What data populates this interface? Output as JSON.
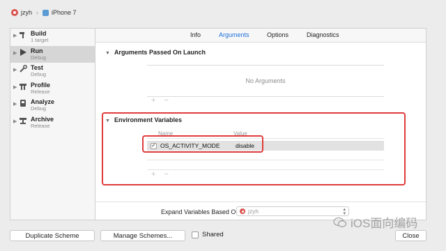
{
  "breadcrumb": {
    "project": "jzyh",
    "device": "iPhone 7"
  },
  "sidebar": {
    "items": [
      {
        "label": "Build",
        "sub": "1 target",
        "icon": "hammer-icon"
      },
      {
        "label": "Run",
        "sub": "Debug",
        "icon": "play-icon"
      },
      {
        "label": "Test",
        "sub": "Debug",
        "icon": "wrench-icon"
      },
      {
        "label": "Profile",
        "sub": "Release",
        "icon": "instruments-icon"
      },
      {
        "label": "Analyze",
        "sub": "Debug",
        "icon": "analyze-icon"
      },
      {
        "label": "Archive",
        "sub": "Release",
        "icon": "archive-icon"
      }
    ]
  },
  "tabs": [
    "Info",
    "Arguments",
    "Options",
    "Diagnostics"
  ],
  "active_tab": "Arguments",
  "arguments": {
    "title": "Arguments Passed On Launch",
    "empty_text": "No Arguments"
  },
  "environment": {
    "title": "Environment Variables",
    "col_name": "Name",
    "col_value": "Value",
    "rows": [
      {
        "checked": true,
        "check_glyph": "✓",
        "name": "OS_ACTIVITY_MODE",
        "value": "disable"
      }
    ]
  },
  "controls": {
    "plus": "+",
    "minus": "−"
  },
  "expand": {
    "label": "Expand Variables Based On",
    "value": "jzyh"
  },
  "footer": {
    "duplicate": "Duplicate Scheme",
    "manage": "Manage Schemes...",
    "shared": "Shared",
    "close": "Close"
  },
  "watermark": "iOS面向编码",
  "colors": {
    "accent": "#1a6fd8",
    "highlight_border": "#e03b3b",
    "selected_row": "#d6d6d6"
  }
}
